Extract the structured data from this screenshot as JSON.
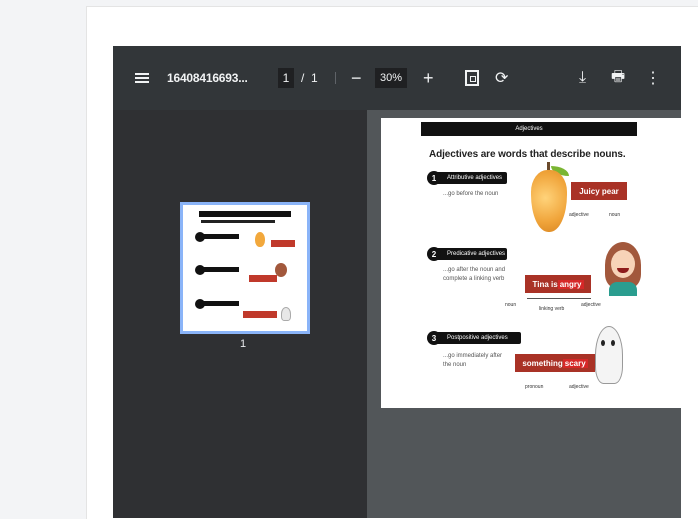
{
  "toolbar": {
    "file_name": "16408416693...",
    "page_current": "1",
    "page_separator": "/",
    "page_total": "1",
    "zoom_out_symbol": "−",
    "zoom_value": "30%",
    "zoom_in_symbol": "+",
    "rotate_symbol": "⟳",
    "download_symbol": "⤓",
    "print_symbol": "🖶",
    "more_symbol": "⋮",
    "icons": [
      "menu-icon",
      "fit-page-icon",
      "rotate-icon",
      "download-icon",
      "print-icon",
      "more-options-icon"
    ]
  },
  "sidebar": {
    "thumbnail_page_number": "1",
    "selected_border_color": "#8ab4f8"
  },
  "document": {
    "title": "Adjectives",
    "subtitle": "Adjectives are words that describe nouns.",
    "sections": [
      {
        "number": "1",
        "label": "Attributive adjectives",
        "description": "...go before the noun",
        "phrase_prefix": "",
        "phrase_highlight": "Juicy pear",
        "phrase_suffix": "",
        "tags": [
          "adjective",
          "noun"
        ]
      },
      {
        "number": "2",
        "label": "Predicative adjectives",
        "description": "...go after the noun and complete a linking verb",
        "phrase_prefix": "Tina is ",
        "phrase_highlight": "angry",
        "phrase_suffix": "",
        "tags": [
          "noun",
          "linking verb",
          "adjective"
        ]
      },
      {
        "number": "3",
        "label": "Postpositive adjectives",
        "description": "...go immediately after the noun",
        "phrase_prefix": "something ",
        "phrase_highlight": "scary",
        "phrase_suffix": "",
        "tags": [
          "pronoun",
          "adjective"
        ]
      }
    ]
  },
  "colors": {
    "toolbar_bg": "#323639",
    "viewer_bg": "#525659",
    "accent_red": "#a93226"
  }
}
